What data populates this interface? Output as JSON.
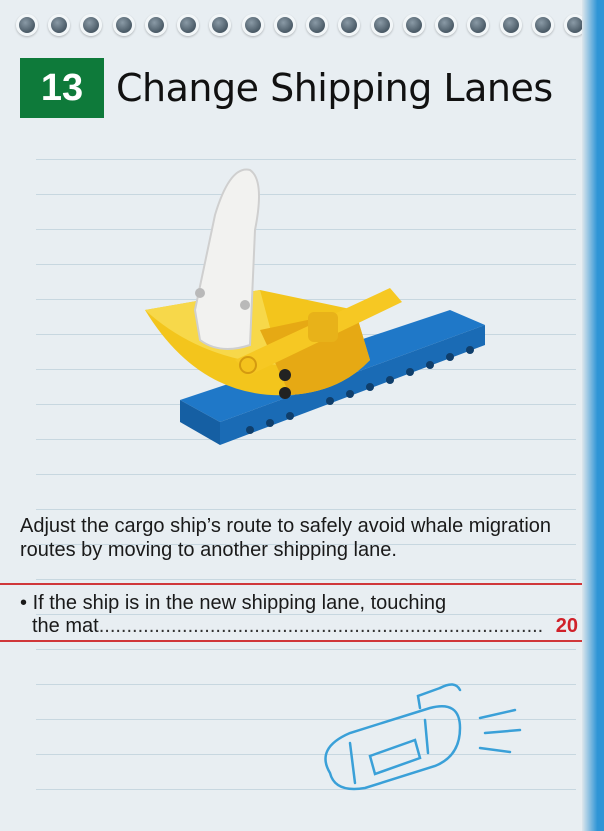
{
  "header": {
    "number": "13",
    "title": "Change Shipping Lanes"
  },
  "description": "Adjust the cargo ship’s route to safely avoid whale migration routes by moving to another shipping lane.",
  "mission": {
    "bullet": "•",
    "line1": "If the ship is in the new shipping lane, touching",
    "line2": "the mat",
    "dots": "...........................................................................................",
    "points": "20"
  },
  "colors": {
    "badge": "#0e7a3a",
    "points": "#d0212a",
    "rule": "#d0373a"
  },
  "icons": [
    "lego-ship-model",
    "submarine-sketch-icon",
    "notebook-ring-icon"
  ]
}
